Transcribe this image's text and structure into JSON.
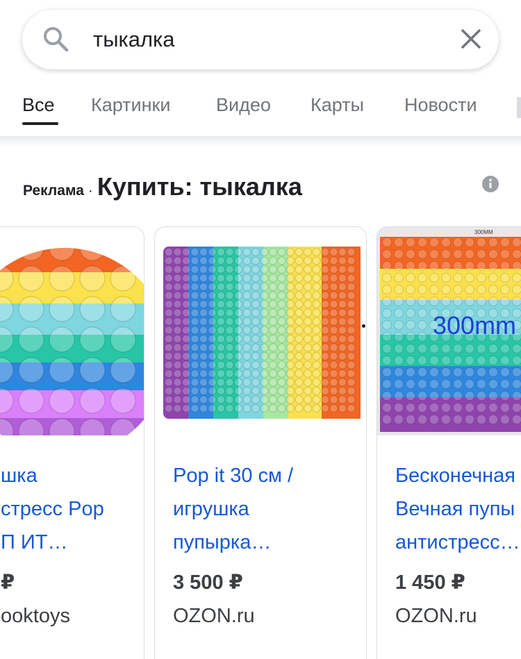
{
  "search": {
    "query": "тыкалка",
    "icon": "search-icon",
    "clear_icon": "close-icon"
  },
  "tabs": [
    {
      "label": "Все",
      "active": true
    },
    {
      "label": "Картинки",
      "active": false
    },
    {
      "label": "Видео",
      "active": false
    },
    {
      "label": "Карты",
      "active": false
    },
    {
      "label": "Новости",
      "active": false
    }
  ],
  "ads": {
    "label": "Реклама",
    "separator": "·",
    "title": "Купить: тыкалка",
    "info_icon": "info-icon"
  },
  "products": [
    {
      "title_lines": [
        "шка",
        "стресс Pop",
        "П ИТ…"
      ],
      "price": "₽",
      "store": "ooktoys"
    },
    {
      "title_lines": [
        "Pop it 30 см /",
        "игрушка",
        "пупырка…"
      ],
      "price": "3 500 ₽",
      "store": "OZON.ru"
    },
    {
      "title_lines": [
        "Бесконечная",
        "Вечная пупы",
        "антистресс…"
      ],
      "price": "1 450 ₽",
      "store": "OZON.ru",
      "image_text": "300mm",
      "image_tag": "300MM"
    }
  ],
  "colors": {
    "link": "#1558d6",
    "text": "#202124",
    "muted": "#70757a",
    "border": "#dadce0",
    "rainbow": [
      "#f26522",
      "#f7b731",
      "#fbe14b",
      "#7ed6df",
      "#26c6a6",
      "#2e86de",
      "#8e44ad",
      "#d980fa"
    ]
  }
}
